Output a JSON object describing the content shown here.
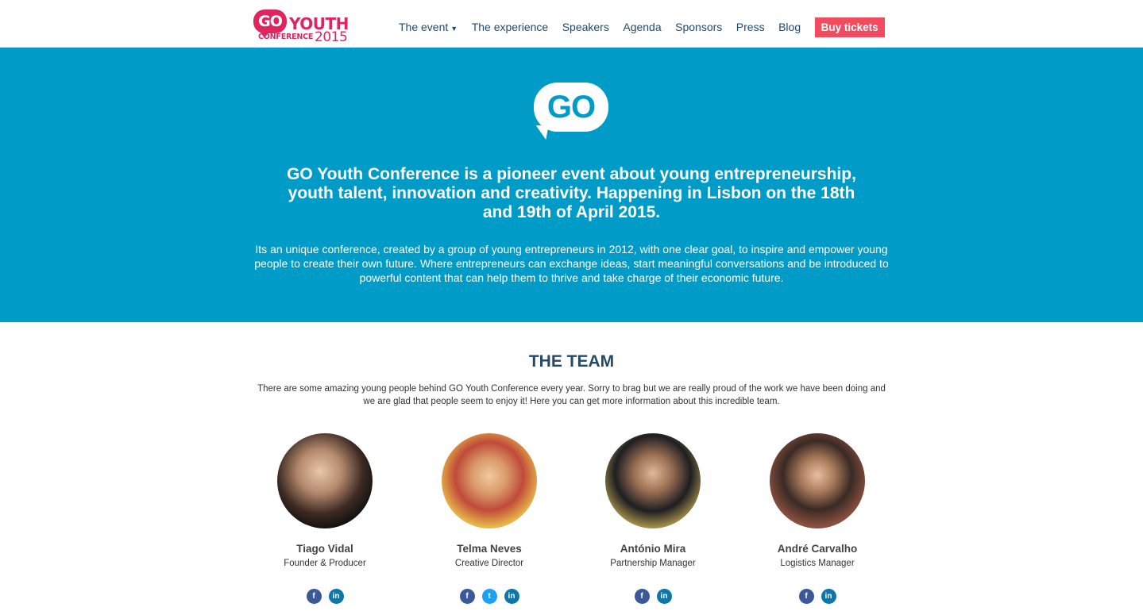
{
  "header": {
    "logo": {
      "go": "GO",
      "youth": "YOUTH",
      "conference": "CONFERENCE",
      "year": "2015"
    },
    "nav": [
      {
        "label": "The event",
        "dropdown": true
      },
      {
        "label": "The experience"
      },
      {
        "label": "Speakers"
      },
      {
        "label": "Agenda"
      },
      {
        "label": "Sponsors"
      },
      {
        "label": "Press"
      },
      {
        "label": "Blog"
      }
    ],
    "buy_label": "Buy tickets"
  },
  "hero": {
    "logo_text": "GO",
    "headline": "GO Youth Conference is a pioneer event about young entrepreneurship, youth talent, innovation and creativity. Happening in Lisbon on the 18th and 19th of April 2015.",
    "body": "Its an unique conference, created by a group of young entrepreneurs in 2012, with one clear goal, to inspire and empower young people to create their own future. Where entrepreneurs can exchange ideas, start meaningful conversations and be introduced to powerful content that can help them to thrive and take charge of their economic future."
  },
  "team": {
    "title": "THE TEAM",
    "intro": "There are some amazing young people behind GO Youth Conference every year. Sorry to brag but we are really proud of the work we have been doing and we are glad that people seem to enjoy it! Here you can get more information about this incredible team.",
    "members": [
      {
        "name": "Tiago Vidal",
        "role": "Founder & Producer",
        "social": [
          "facebook",
          "linkedin"
        ]
      },
      {
        "name": "Telma Neves",
        "role": "Creative Director",
        "social": [
          "facebook",
          "twitter",
          "linkedin"
        ]
      },
      {
        "name": "António Mira",
        "role": "Partnership Manager",
        "social": [
          "facebook",
          "linkedin"
        ]
      },
      {
        "name": "André Carvalho",
        "role": "Logistics Manager",
        "social": [
          "facebook",
          "linkedin"
        ]
      }
    ]
  },
  "colors": {
    "brand_pink": "#e0245e",
    "hero_blue": "#009cc7",
    "nav_text": "#244a6b",
    "buy_button": "#f04b5e"
  },
  "icons": {
    "dropdown": "caret-down-icon",
    "facebook": "facebook-icon",
    "twitter": "twitter-icon",
    "linkedin": "linkedin-icon"
  }
}
